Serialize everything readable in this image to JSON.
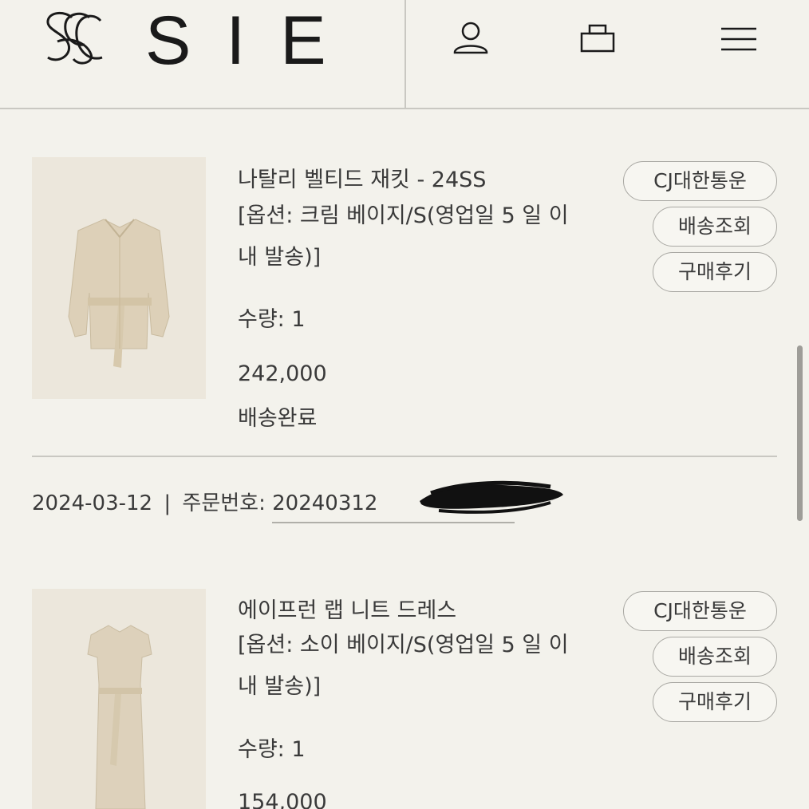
{
  "brand": {
    "name": "SIE"
  },
  "header": {
    "icons": [
      "user-icon",
      "shopping-bag-icon",
      "menu-icon"
    ]
  },
  "products": [
    {
      "name": "나탈리 벨티드 재킷 - 24SS",
      "option": "[옵션: 크림 베이지/S(영업일 5 일 이내 발송)]",
      "qty": "수량: 1",
      "price": "242,000",
      "status": "배송완료",
      "buttons": {
        "carrier": "CJ대한통운",
        "track": "배송조회",
        "review": "구매후기"
      }
    },
    {
      "name": "에이프런 랩 니트 드레스",
      "option": "[옵션: 소이 베이지/S(영업일 5 일 이내 발송)]",
      "qty": "수량: 1",
      "price": "154,000",
      "buttons": {
        "carrier": "CJ대한통운",
        "track": "배송조회",
        "review": "구매후기"
      }
    }
  ],
  "order": {
    "date": "2024-03-12",
    "separator": "|",
    "number_label": "주문번호:",
    "number_visible": "20240312"
  },
  "colors": {
    "background": "#f3f2ec",
    "text": "#3a3a3a",
    "border": "#c9c8c2"
  }
}
